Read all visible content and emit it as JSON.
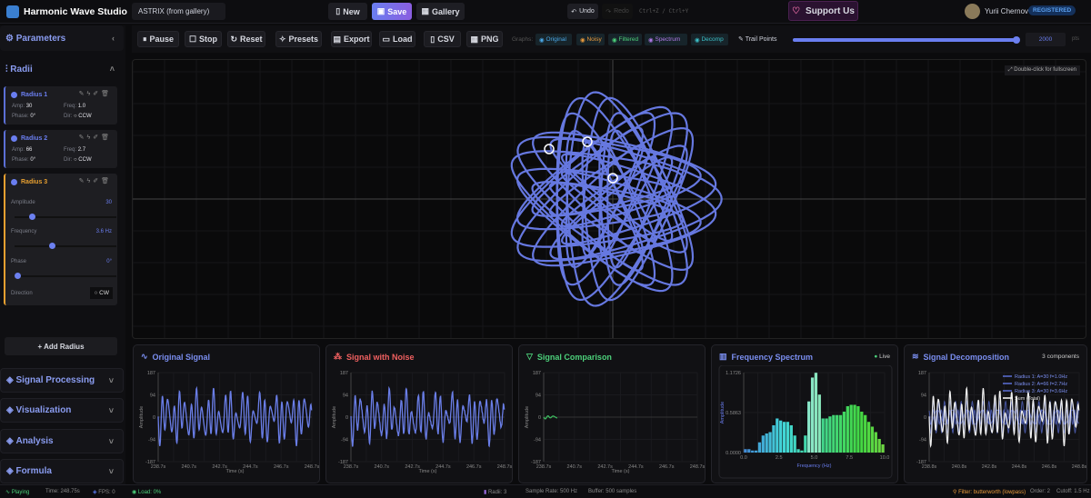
{
  "app": {
    "title": "Harmonic Wave Studio",
    "project_name": "ASTRIX (from gallery)",
    "new": "New",
    "save": "Save",
    "gallery": "Gallery",
    "undo": "Undo",
    "redo": "Redo",
    "shortcuts": "Ctrl+Z / Ctrl+Y",
    "support": "Support Us",
    "user": "Yurii Chernov",
    "badge": "REGISTERED"
  },
  "toolbar": {
    "pause": "Pause",
    "stop": "Stop",
    "reset": "Reset",
    "presets": "Presets",
    "export": "Export",
    "load": "Load",
    "csv": "CSV",
    "png": "PNG",
    "graphs_label": "Graphs:",
    "graphs": [
      {
        "label": "Original",
        "color": "#4aa8e8"
      },
      {
        "label": "Noisy",
        "color": "#e89a3c"
      },
      {
        "label": "Filtered",
        "color": "#4cd07a"
      },
      {
        "label": "Spectrum",
        "color": "#b07ae8"
      },
      {
        "label": "Decomp",
        "color": "#3cc0c8"
      }
    ],
    "trail_label": "Trail Points",
    "trail_value": "2000",
    "trail_fraction": 0.99,
    "trail_unit": "pts"
  },
  "sidebar": {
    "title": "Parameters",
    "radii_title": "Radii",
    "radii": [
      {
        "name": "Radius 1",
        "amp": 30,
        "freq": 1.0,
        "phase": "0°",
        "dir": "CCW",
        "amp_label": "Amp:",
        "freq_label": "Freq:",
        "phase_label": "Phase:",
        "dir_label": "Dir:",
        "amp_text": "30",
        "freq_text": "1.0",
        "dir_text": "○ CCW"
      },
      {
        "name": "Radius 2",
        "amp": 66,
        "freq": 2.7,
        "phase": "0°",
        "dir": "CCW",
        "amp_label": "Amp:",
        "freq_label": "Freq:",
        "phase_label": "Phase:",
        "dir_label": "Dir:",
        "amp_text": "66",
        "freq_text": "2.7",
        "dir_text": "○ CCW"
      },
      {
        "name": "Radius 3",
        "amp": 30,
        "freq": 3.6,
        "phase": "0°",
        "dir": "CW",
        "amp_label": "Amplitude",
        "freq_label": "Frequency",
        "phase_label": "Phase",
        "dir_label": "Direction",
        "amp_text": "30",
        "freq_text": "3.6 Hz",
        "dir_text": "○ CW",
        "amp_fraction": 0.15,
        "freq_fraction": 0.36,
        "phase_fraction": 0
      }
    ],
    "add_radius": "+ Add Radius",
    "sections": [
      "Signal Processing",
      "Visualization",
      "Analysis",
      "Formula"
    ]
  },
  "canvas": {
    "hint": "Double-click for fullscreen",
    "curve_color": "#6678e0"
  },
  "chart_data": [
    {
      "type": "line",
      "title": "Original Signal",
      "ylabel": "Amplitude",
      "xlabel": "Time (s)",
      "yticks": [
        "187",
        "94",
        "0",
        "-94",
        "-187"
      ],
      "xticks": [
        "238.7s",
        "240.7s",
        "242.7s",
        "244.7s",
        "246.7s",
        "248.7s"
      ],
      "ylim": [
        -187,
        187
      ],
      "color": "#6a7ee8"
    },
    {
      "type": "line",
      "title": "Signal with Noise",
      "ylabel": "Amplitude",
      "xlabel": "Time (s)",
      "yticks": [
        "187",
        "94",
        "0",
        "-94",
        "-187"
      ],
      "xticks": [
        "238.7s",
        "240.7s",
        "242.7s",
        "244.7s",
        "246.7s",
        "248.7s"
      ],
      "ylim": [
        -187,
        187
      ],
      "color": "#6a7ee8"
    },
    {
      "type": "line",
      "title": "Signal Comparison",
      "ylabel": "Amplitude",
      "xlabel": "Time (s)",
      "yticks": [
        "187",
        "94",
        "0",
        "-94",
        "-187"
      ],
      "xticks": [
        "238.7s",
        "240.7s",
        "242.7s",
        "244.7s",
        "246.7s",
        "248.7s"
      ],
      "ylim": [
        -187,
        187
      ],
      "color": "#3cc060"
    },
    {
      "type": "bar",
      "title": "Frequency Spectrum",
      "status": "Live",
      "ylabel": "Amplitude",
      "xlabel": "Frequency (Hz)",
      "yticks": [
        "1.1726",
        "0.5863",
        "0.0000"
      ],
      "xticks": [
        "0.0",
        "2.5",
        "5.0",
        "7.5",
        "10.0"
      ],
      "xlim": [
        0,
        10
      ],
      "ylim": [
        0,
        1.1726
      ],
      "x": [
        0.25,
        0.5,
        0.75,
        1,
        1.25,
        1.5,
        1.75,
        2,
        2.25,
        2.5,
        2.75,
        3,
        3.25,
        3.5,
        3.75,
        4,
        4.25,
        4.5,
        4.75,
        5,
        5.25,
        5.5,
        5.75,
        6,
        6.25,
        6.5,
        6.75,
        7,
        7.25,
        7.5,
        7.75,
        8,
        8.25,
        8.5,
        8.75,
        9,
        9.25,
        9.5,
        9.75,
        10
      ],
      "values": [
        0.05,
        0.05,
        0.03,
        0.03,
        0.15,
        0.25,
        0.28,
        0.3,
        0.4,
        0.5,
        0.47,
        0.45,
        0.45,
        0.4,
        0.25,
        0.05,
        0.03,
        0.25,
        0.75,
        1.1,
        1.17,
        0.85,
        0.5,
        0.5,
        0.53,
        0.55,
        0.55,
        0.55,
        0.6,
        0.68,
        0.7,
        0.7,
        0.68,
        0.6,
        0.55,
        0.45,
        0.38,
        0.3,
        0.2,
        0.12
      ]
    },
    {
      "type": "line",
      "title": "Signal Decomposition",
      "count": "3 components",
      "yticks": [
        "187",
        "94",
        "0",
        "-94",
        "-187"
      ],
      "xticks": [
        "238.8s",
        "240.8s",
        "242.8s",
        "244.8s",
        "246.8s",
        "248.8s"
      ],
      "ylim": [
        -187,
        187
      ],
      "series": [
        {
          "name": "Radius 1: A=30 f=1.0Hz",
          "color": "#5b6fd6"
        },
        {
          "name": "Radius 2: A=66 f=2.7Hz",
          "color": "#5b6fd6"
        },
        {
          "name": "Radius 3: A=30 f=3.6Hz",
          "color": "#5b6fd6"
        },
        {
          "name": "Sum (Total)",
          "color": "#ffffff"
        }
      ]
    }
  ],
  "status": {
    "playing": "Playing",
    "time": "Time: 248.75s",
    "fps": "FPS: 0",
    "load": "Load: 0%",
    "radii": "Radii: 3",
    "sample_rate": "Sample Rate: 500 Hz",
    "buffer": "Buffer: 500 samples",
    "filter": "Filter: butterworth (lowpass)",
    "order": "Order: 2",
    "cutoff": "Cutoff: 1.5 Hz"
  }
}
